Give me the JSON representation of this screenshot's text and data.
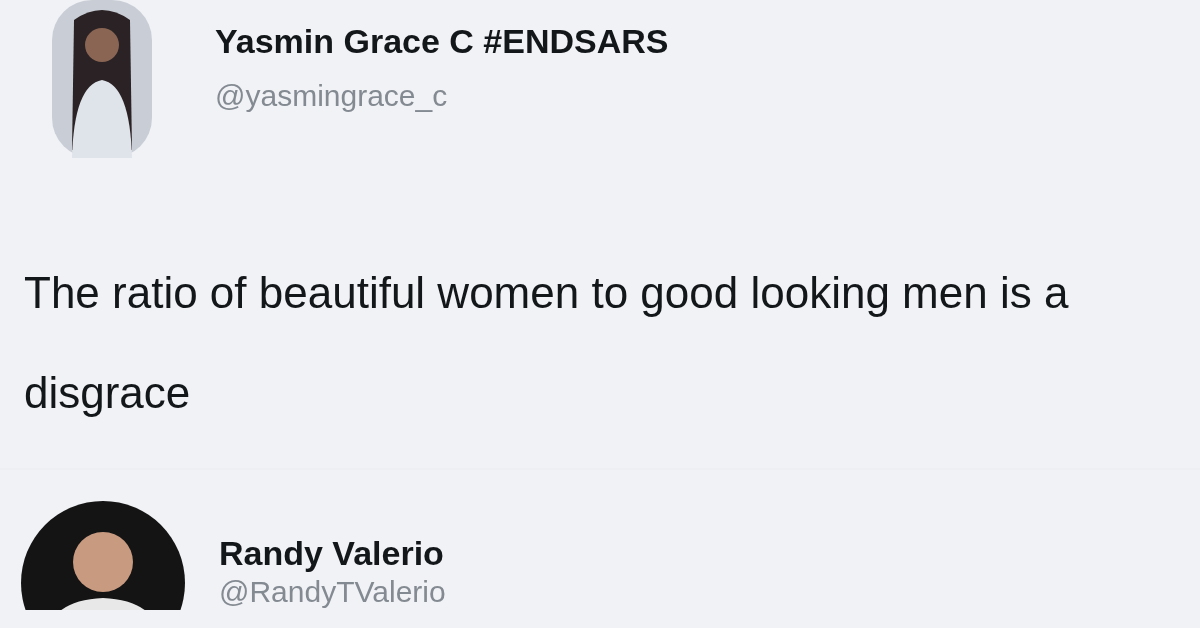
{
  "tweets": [
    {
      "name": "Yasmin Grace C #ENDSARS",
      "handle": "@yasmingrace_c",
      "text": "The ratio of beautiful women to good looking men is a disgrace"
    },
    {
      "name": "Randy Valerio",
      "handle": "@RandyTValerio"
    }
  ]
}
